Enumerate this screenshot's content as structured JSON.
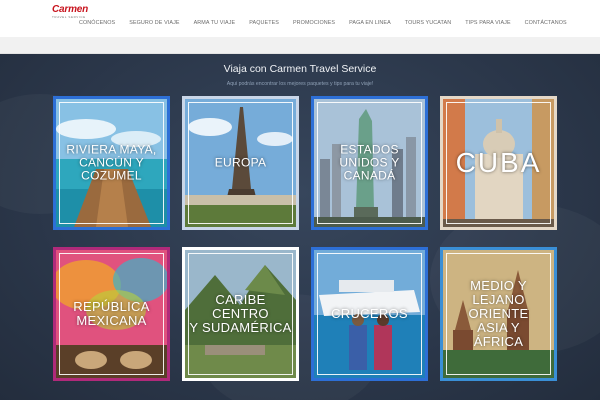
{
  "header": {
    "logo_main": "Carmen",
    "logo_sub": "TRAVEL SERVICE",
    "nav": [
      "CONÓCENOS",
      "SEGURO DE VIAJE",
      "ARMA TU VIAJE",
      "PAQUETES",
      "PROMOCIONES",
      "PAGA EN LINEA",
      "TOURS YUCATAN",
      "TIPS PARA VIAJE",
      "CONTÁCTANOS"
    ]
  },
  "main": {
    "title": "Viaja con Carmen Travel Service",
    "subtitle": "Aqui podrás encontrar los mejores paquetes y tips para tu viaje!"
  },
  "cards": [
    {
      "label": "RIVIERA MAYA,\nCANCÚN Y\nCOZUMEL",
      "sky": "#7fb8de",
      "ground": "#2fa0b8",
      "frame": "#2d6fd6"
    },
    {
      "label": "EUROPA",
      "sky": "#6fa9d8",
      "ground": "#5a6a3a",
      "frame": "#c9d6e8"
    },
    {
      "label": "ESTADOS\nUNIDOS Y\nCANADÁ",
      "sky": "#9fbad2",
      "ground": "#5c6b5a",
      "frame": "#2d6fd6"
    },
    {
      "label": "CUBA",
      "sky": "#8fb6d8",
      "ground": "#c28a57",
      "frame": "#e4d8c8"
    },
    {
      "label": "REPÚBLICA\nMEXICANA",
      "sky": "#d84b7a",
      "ground": "#6b4a2e",
      "frame": "#b02a7a"
    },
    {
      "label": "CARIBE\nCENTRO\nY SUDAMÉRICA",
      "sky": "#94b3c8",
      "ground": "#5f7a3b",
      "frame": "#ffffff"
    },
    {
      "label": "CRUCEROS",
      "sky": "#6aa7d8",
      "ground": "#1f7fb8",
      "frame": "#2d6fd6"
    },
    {
      "label": "MEDIO Y\nLEJANO\nORIENTE\nASIA Y\nÁFRICA",
      "sky": "#c9b07a",
      "ground": "#3f6b3a",
      "frame": "#3a8fd6"
    }
  ]
}
